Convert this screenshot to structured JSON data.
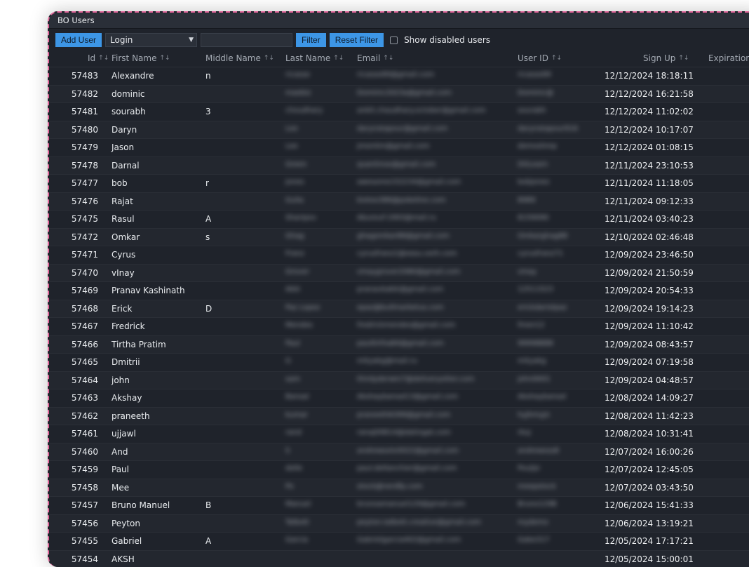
{
  "window": {
    "title": "BO Users"
  },
  "toolbar": {
    "add_user_label": "Add User",
    "field_select_value": "Login",
    "filter_value": "",
    "filter_label": "Filter",
    "reset_filter_label": "Reset Filter",
    "show_disabled_label": "Show disabled users",
    "show_disabled_checked": false
  },
  "table": {
    "columns": [
      "Id",
      "First Name",
      "Middle Name",
      "Last Name",
      "Email",
      "User ID",
      "Sign Up",
      "Expiration D"
    ],
    "sort_icons": {
      "id": "↑↓",
      "default": "↑↓"
    },
    "rows": [
      {
        "id": "57483",
        "first": "Alexandre",
        "middle": "n",
        "last": "ricasse",
        "email": "ricasse89@gmail.com",
        "userid": "ricasse89",
        "signup": "12/12/2024 18:18:11"
      },
      {
        "id": "57482",
        "first": "dominic",
        "middle": "",
        "last": "maebiz",
        "email": "Dominic2023a@gmail.com",
        "userid": "Dominic@",
        "signup": "12/12/2024 16:21:58"
      },
      {
        "id": "57481",
        "first": "sourabh",
        "middle": "3",
        "last": "choudhary",
        "email": "ankit.chaudhary.october@gmail.com",
        "userid": "sourabh",
        "signup": "12/12/2024 11:02:02"
      },
      {
        "id": "57480",
        "first": "Daryn",
        "middle": "",
        "last": "Lee",
        "email": "darynstapour@gmail.com",
        "userid": "darynstapour916",
        "signup": "12/12/2024 10:17:07"
      },
      {
        "id": "57479",
        "first": "Jason",
        "middle": "",
        "last": "Lee",
        "email": "jmsmtm@gmail.com",
        "userid": "demoshmp",
        "signup": "12/12/2024 01:08:15"
      },
      {
        "id": "57478",
        "first": "Darnal",
        "middle": "",
        "last": "Green",
        "email": "quantinox@gmail.com",
        "userid": "DGLearn",
        "signup": "12/11/2024 23:10:53"
      },
      {
        "id": "57477",
        "first": "bob",
        "middle": "r",
        "last": "jones",
        "email": "awesome152234@gmail.com",
        "userid": "bobjones",
        "signup": "12/11/2024 11:18:05"
      },
      {
        "id": "57476",
        "first": "Rajat",
        "middle": "",
        "last": "Gulia",
        "email": "kiotoo386@pokeline.com",
        "userid": "8989",
        "signup": "12/11/2024 09:12:33"
      },
      {
        "id": "57475",
        "first": "Rasul",
        "middle": "A",
        "last": "Sharipov",
        "email": "Abureuf-1993@mail.ru",
        "userid": "8159090",
        "signup": "12/11/2024 03:40:23"
      },
      {
        "id": "57472",
        "first": "Omkar",
        "middle": "s",
        "last": "Ghag",
        "email": "ghagomkar88@gmail.com",
        "userid": "Omkarghag88",
        "signup": "12/10/2024 02:46:48"
      },
      {
        "id": "57471",
        "first": "Cyrus",
        "middle": "",
        "last": "Franz",
        "email": "cyrusfranz1@easu.verh.com",
        "userid": "cyrusfranz71",
        "signup": "12/09/2024 23:46:50"
      },
      {
        "id": "57470",
        "first": "vInay",
        "middle": "",
        "last": "Grover",
        "email": "vinaygrover2080@gmail.com",
        "userid": "vinay",
        "signup": "12/09/2024 21:50:59"
      },
      {
        "id": "57469",
        "first": "Pranav Kashinath",
        "middle": "",
        "last": "Akki",
        "email": "pranavkakki@gmail.com",
        "userid": "12511523",
        "signup": "12/09/2024 20:54:33"
      },
      {
        "id": "57468",
        "first": "Erick",
        "middle": "D",
        "last": "Paz Lopez",
        "email": "epaz@bullmarketus.com",
        "userid": "erickdarielpaz",
        "signup": "12/09/2024 19:14:23"
      },
      {
        "id": "57467",
        "first": "Fredrick",
        "middle": "",
        "last": "Mendes",
        "email": "fredrickmendes@gmail.com",
        "userid": "fmen12",
        "signup": "12/09/2024 11:10:42"
      },
      {
        "id": "57466",
        "first": "Tirtha Pratim",
        "middle": "",
        "last": "Paul",
        "email": "paultirtha84@gmail.com",
        "userid": "99998888",
        "signup": "12/09/2024 08:43:57"
      },
      {
        "id": "57465",
        "first": "Dmitrii",
        "middle": "",
        "last": "G",
        "email": "mityakg@mail.ru",
        "userid": "mityakg",
        "signup": "12/09/2024 07:19:58"
      },
      {
        "id": "57464",
        "first": "john",
        "middle": "",
        "last": "sam",
        "email": "thirdyderwin7@deliveryotter.com",
        "userid": "john0001",
        "signup": "12/09/2024 04:48:57"
      },
      {
        "id": "57463",
        "first": "Akshay",
        "middle": "",
        "last": "Bansal",
        "email": "Akshaybansal13@gmail.com",
        "userid": "Akshaybansal",
        "signup": "12/08/2024 14:09:27"
      },
      {
        "id": "57462",
        "first": "praneeth",
        "middle": "",
        "last": "kumar",
        "email": "praneeth6399@gmail.com",
        "userid": "hyjhmyjn",
        "signup": "12/08/2024 11:42:23"
      },
      {
        "id": "57461",
        "first": "ujjawl",
        "middle": "",
        "last": "rand",
        "email": "ranaj09814@datingat.com",
        "userid": "rkuj",
        "signup": "12/08/2024 10:31:41"
      },
      {
        "id": "57460",
        "first": "And",
        "middle": "",
        "last": "S",
        "email": "andrewsolvit022@gmail.com",
        "userid": "andrewsss8",
        "signup": "12/07/2024 16:00:26"
      },
      {
        "id": "57459",
        "first": "Paul",
        "middle": "",
        "last": "delle",
        "email": "paul.dellanchier@gmail.com",
        "userid": "Pouljsi",
        "signup": "12/07/2024 12:45:05"
      },
      {
        "id": "57458",
        "first": "Mee",
        "middle": "",
        "last": "Po",
        "email": "stock@nerdfp.com",
        "userid": "meepstock",
        "signup": "12/07/2024 03:43:50"
      },
      {
        "id": "57457",
        "first": "Bruno Manuel",
        "middle": "B",
        "last": "Manuel",
        "email": "brunoamanuel129@gmail.com",
        "userid": "Bruno129B",
        "signup": "12/06/2024 15:41:33"
      },
      {
        "id": "57456",
        "first": "Peyton",
        "middle": "",
        "last": "Talbott",
        "email": "peyton.talbott.creative@gmail.com",
        "userid": "mydemo",
        "signup": "12/06/2024 13:19:21"
      },
      {
        "id": "57455",
        "first": "Gabriel",
        "middle": "A",
        "last": "Garcia",
        "email": "Gabrielgarcia402@gmail.com",
        "userid": "Gabe317",
        "signup": "12/05/2024 17:17:21"
      },
      {
        "id": "57454",
        "first": "AKSH",
        "middle": "",
        "last": "",
        "email": "",
        "userid": "",
        "signup": "12/05/2024 15:00:01"
      }
    ]
  }
}
